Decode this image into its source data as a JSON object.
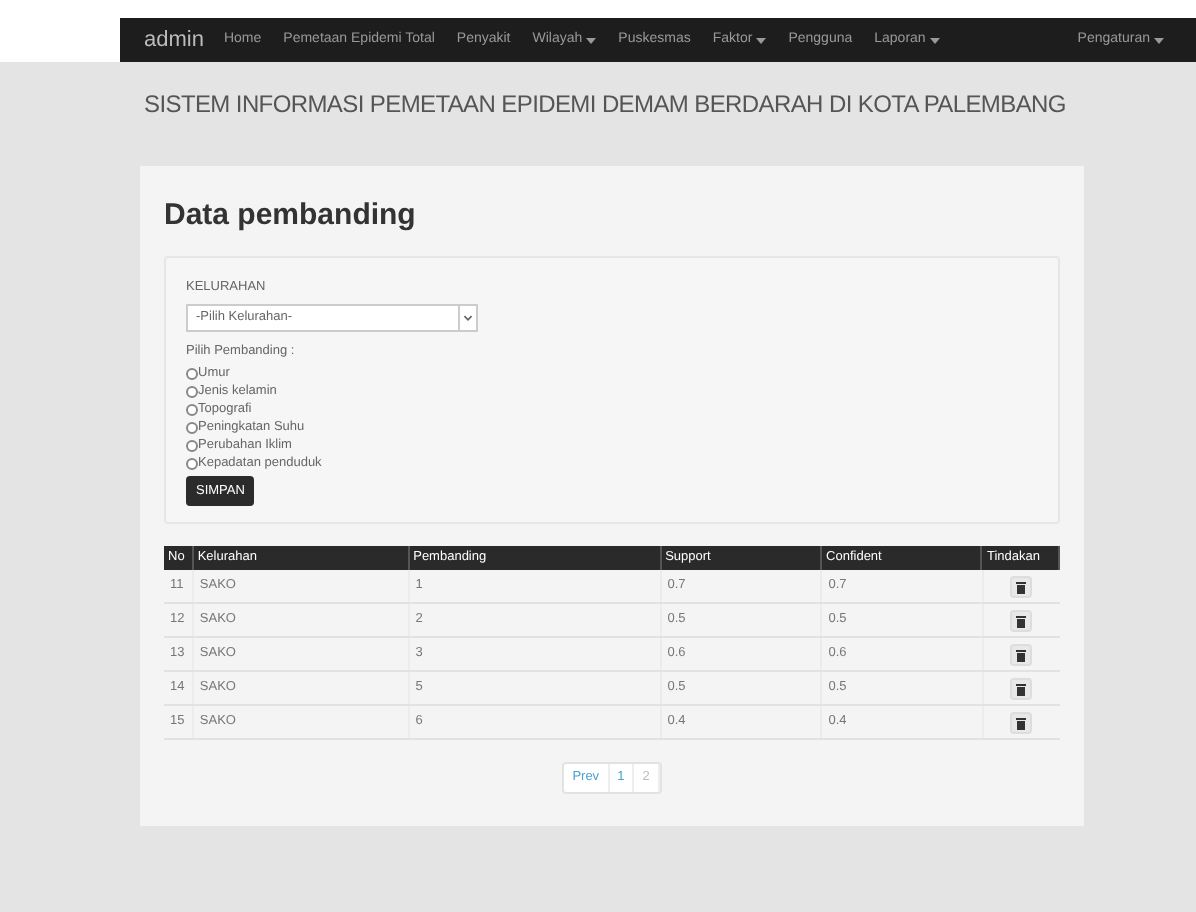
{
  "navbar": {
    "brand": "admin",
    "items": [
      {
        "label": "Home",
        "dropdown": false
      },
      {
        "label": "Pemetaan Epidemi Total",
        "dropdown": false
      },
      {
        "label": "Penyakit",
        "dropdown": false
      },
      {
        "label": "Wilayah",
        "dropdown": true
      },
      {
        "label": "Puskesmas",
        "dropdown": false
      },
      {
        "label": "Faktor",
        "dropdown": true
      },
      {
        "label": "Pengguna",
        "dropdown": false
      },
      {
        "label": "Laporan",
        "dropdown": true
      }
    ],
    "right_item": {
      "label": "Pengaturan",
      "dropdown": true
    }
  },
  "page_title": "SISTEM INFORMASI PEMETAAN EPIDEMI DEMAM BERDARAH DI KOTA PALEMBANG",
  "card": {
    "title": "Data pembanding",
    "form": {
      "kelurahan_label": "KELURAHAN",
      "kelurahan_select": {
        "value": "-Pilih Kelurahan-"
      },
      "pembanding_label": "Pilih Pembanding :",
      "options": [
        {
          "label": "Umur",
          "checked": false
        },
        {
          "label": "Jenis kelamin",
          "checked": false
        },
        {
          "label": "Topografi",
          "checked": false
        },
        {
          "label": "Peningkatan Suhu",
          "checked": false
        },
        {
          "label": "Perubahan Iklim",
          "checked": false
        },
        {
          "label": "Kepadatan penduduk",
          "checked": false
        }
      ],
      "submit": "SIMPAN"
    },
    "table": {
      "columns": [
        "No",
        "Kelurahan",
        "Pembanding",
        "Support",
        "Confident",
        "Tindakan"
      ],
      "rows": [
        [
          "11",
          "SAKO",
          "1",
          "0.7",
          "0.7"
        ],
        [
          "12",
          "SAKO",
          "2",
          "0.5",
          "0.5"
        ],
        [
          "13",
          "SAKO",
          "3",
          "0.6",
          "0.6"
        ],
        [
          "14",
          "SAKO",
          "5",
          "0.5",
          "0.5"
        ],
        [
          "15",
          "SAKO",
          "6",
          "0.4",
          "0.4"
        ]
      ]
    },
    "pagination": [
      {
        "label": "Prev",
        "disabled": false
      },
      {
        "label": "1",
        "disabled": false
      },
      {
        "label": "2",
        "disabled": true
      }
    ]
  }
}
